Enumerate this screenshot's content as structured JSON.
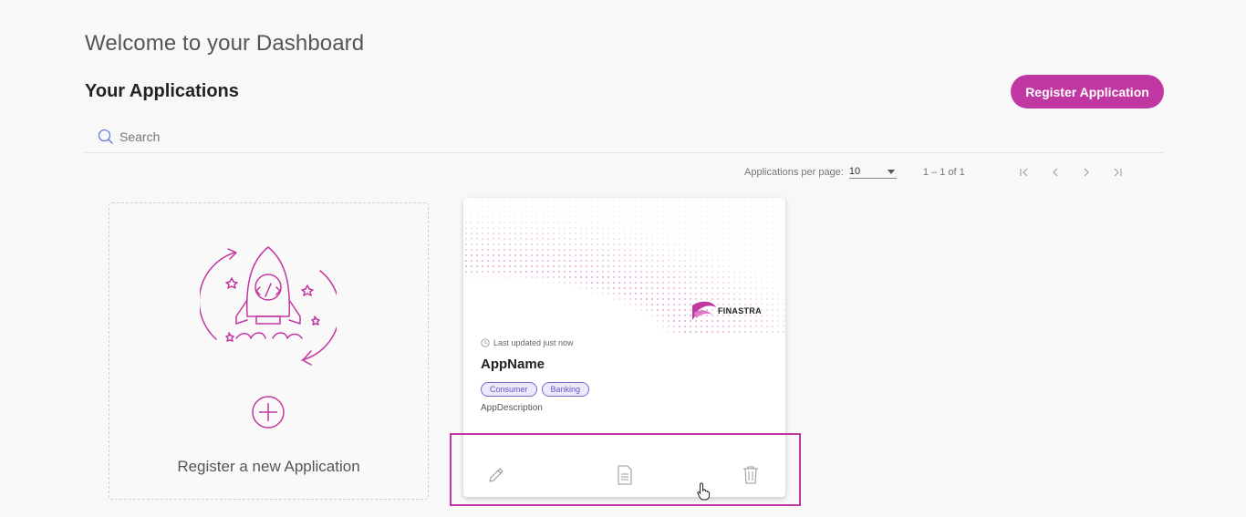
{
  "header": {
    "welcome": "Welcome to your Dashboard",
    "section_title": "Your Applications",
    "register_button": "Register Application"
  },
  "search": {
    "placeholder": "Search",
    "icon": "search-icon"
  },
  "paginator": {
    "per_page_label": "Applications per page:",
    "per_page_value": "10",
    "range": "1 – 1 of 1"
  },
  "new_app_card": {
    "label": "Register a new Application",
    "illustration": "rocket-code-icon"
  },
  "apps": [
    {
      "brand": "FINASTRA",
      "updated": "Last updated just now",
      "name": "AppName",
      "tags": [
        "Consumer",
        "Banking"
      ],
      "description": "AppDescription"
    }
  ],
  "colors": {
    "accent": "#c137a2",
    "chip_text": "#6b55c6",
    "chip_bg": "#ede8fb"
  }
}
